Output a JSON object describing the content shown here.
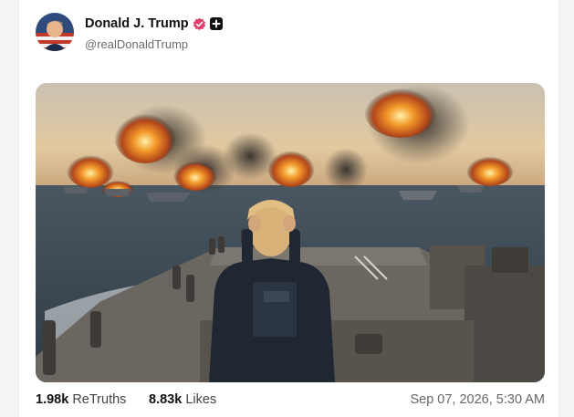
{
  "post": {
    "author": {
      "display_name": "Donald J. Trump",
      "handle": "@realDonaldTrump",
      "verified_icon": "verified-badge-icon",
      "extra_badge_icon": "plus-badge-icon"
    },
    "stats": {
      "retruths_count": "1.98k",
      "retruths_label": "ReTruths",
      "likes_count": "8.83k",
      "likes_label": "Likes"
    },
    "timestamp": "Sep 07, 2026, 5:30 AM"
  },
  "colors": {
    "verified": "#e23f6e",
    "text_primary": "#111111",
    "text_secondary": "#6b6b6b"
  }
}
